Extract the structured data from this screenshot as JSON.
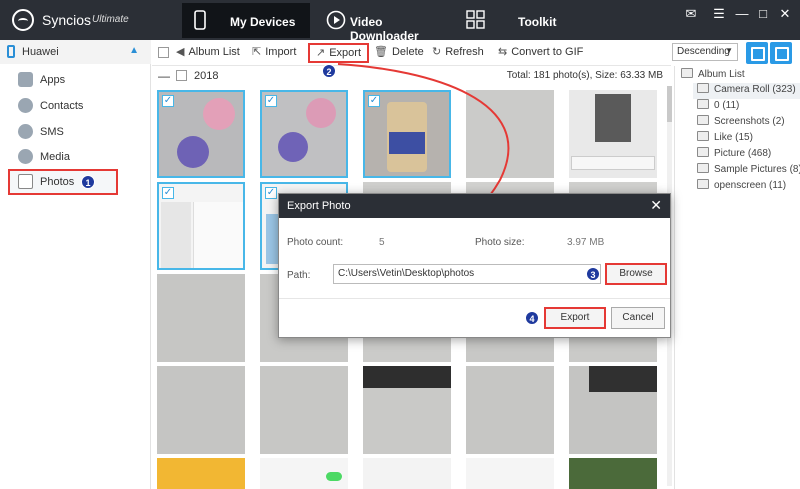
{
  "app": {
    "name": "Syncios",
    "edition": "Ultimate"
  },
  "nav": {
    "devices": "My Devices",
    "video": "Video Downloader",
    "toolkit": "Toolkit"
  },
  "sidebar": {
    "device": "Huawei",
    "items": [
      {
        "label": "Apps",
        "icon": "apps-icon"
      },
      {
        "label": "Contacts",
        "icon": "contacts-icon"
      },
      {
        "label": "SMS",
        "icon": "sms-icon"
      },
      {
        "label": "Media",
        "icon": "media-icon"
      },
      {
        "label": "Photos",
        "icon": "photos-icon"
      }
    ]
  },
  "toolbar": {
    "album_list": "Album List",
    "import": "Import",
    "export": "Export",
    "delete": "Delete",
    "refresh": "Refresh",
    "convert": "Convert to GIF",
    "sort": "Descending"
  },
  "yearbar": {
    "year": "2018",
    "total": "Total: 181 photo(s), Size: 63.33 MB"
  },
  "albums": {
    "header": "Album List",
    "items": [
      "Camera Roll (323)",
      "0 (11)",
      "Screenshots (2)",
      "Like (15)",
      "Picture (468)",
      "Sample Pictures (8)",
      "openscreen (11)"
    ]
  },
  "dialog": {
    "title": "Export Photo",
    "count_label": "Photo count:",
    "count_value": "5",
    "size_label": "Photo size:",
    "size_value": "3.97 MB",
    "path_label": "Path:",
    "path_value": "C:\\Users\\Vetin\\Desktop\\photos",
    "browse": "Browse",
    "export": "Export",
    "cancel": "Cancel"
  },
  "steps": [
    "1",
    "2",
    "3",
    "4"
  ],
  "colors": {
    "titlebar": "#2b2f36",
    "accent": "#2a9ae6",
    "highlight": "#e53935",
    "step": "#1f3a9e"
  }
}
